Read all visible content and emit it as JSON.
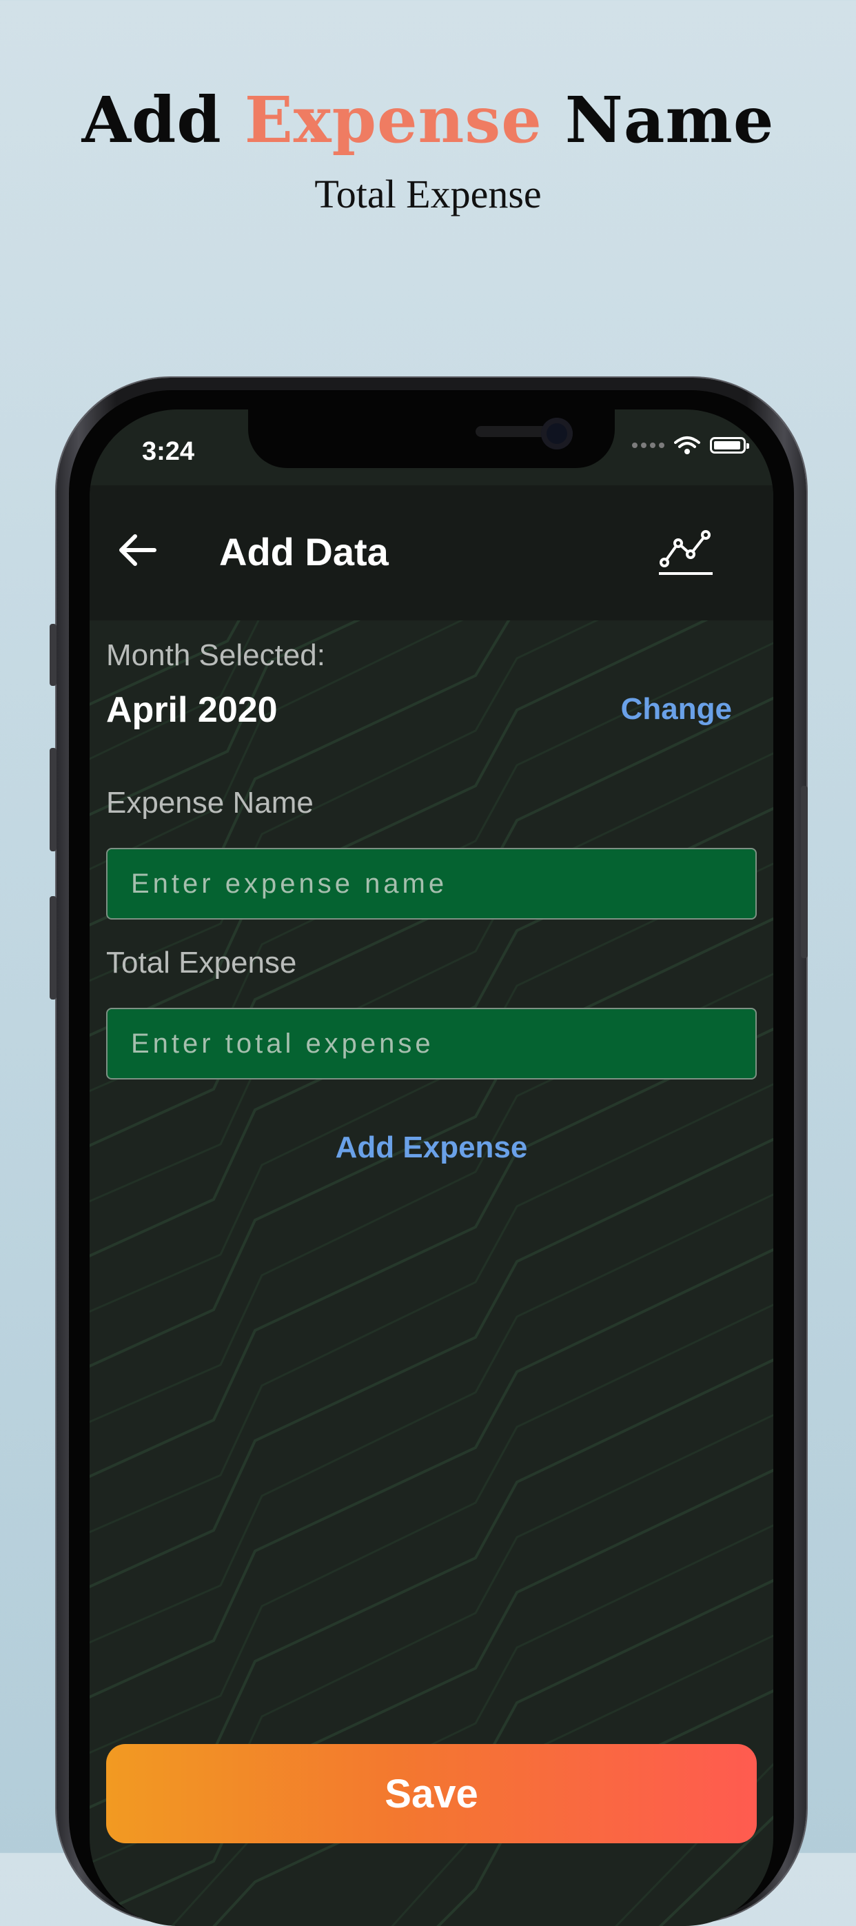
{
  "promo": {
    "headline_part1": "Add",
    "headline_accent": "Expense",
    "headline_part3": "Name",
    "subtitle": "Total Expense",
    "accent_color": "#ef7c62"
  },
  "status_bar": {
    "time": "3:24",
    "icons": [
      "signal-dots-icon",
      "wifi-icon",
      "battery-icon"
    ]
  },
  "app_bar": {
    "title": "Add Data",
    "back_icon": "arrow-left-icon",
    "chart_icon": "line-chart-icon"
  },
  "month": {
    "label": "Month Selected:",
    "value": "April 2020",
    "change_label": "Change"
  },
  "expense_name": {
    "label": "Expense Name",
    "value": "",
    "placeholder": "Enter expense name"
  },
  "total_expense": {
    "label": "Total Expense",
    "value": "",
    "placeholder": "Enter total expense"
  },
  "add_expense_label": "Add Expense",
  "save_label": "Save",
  "colors": {
    "input_bg": "#056331",
    "link": "#6aa1e8",
    "save_gradient_start": "#f29a22",
    "save_gradient_end": "#ff5b50",
    "screen_bg": "#1d241f"
  }
}
